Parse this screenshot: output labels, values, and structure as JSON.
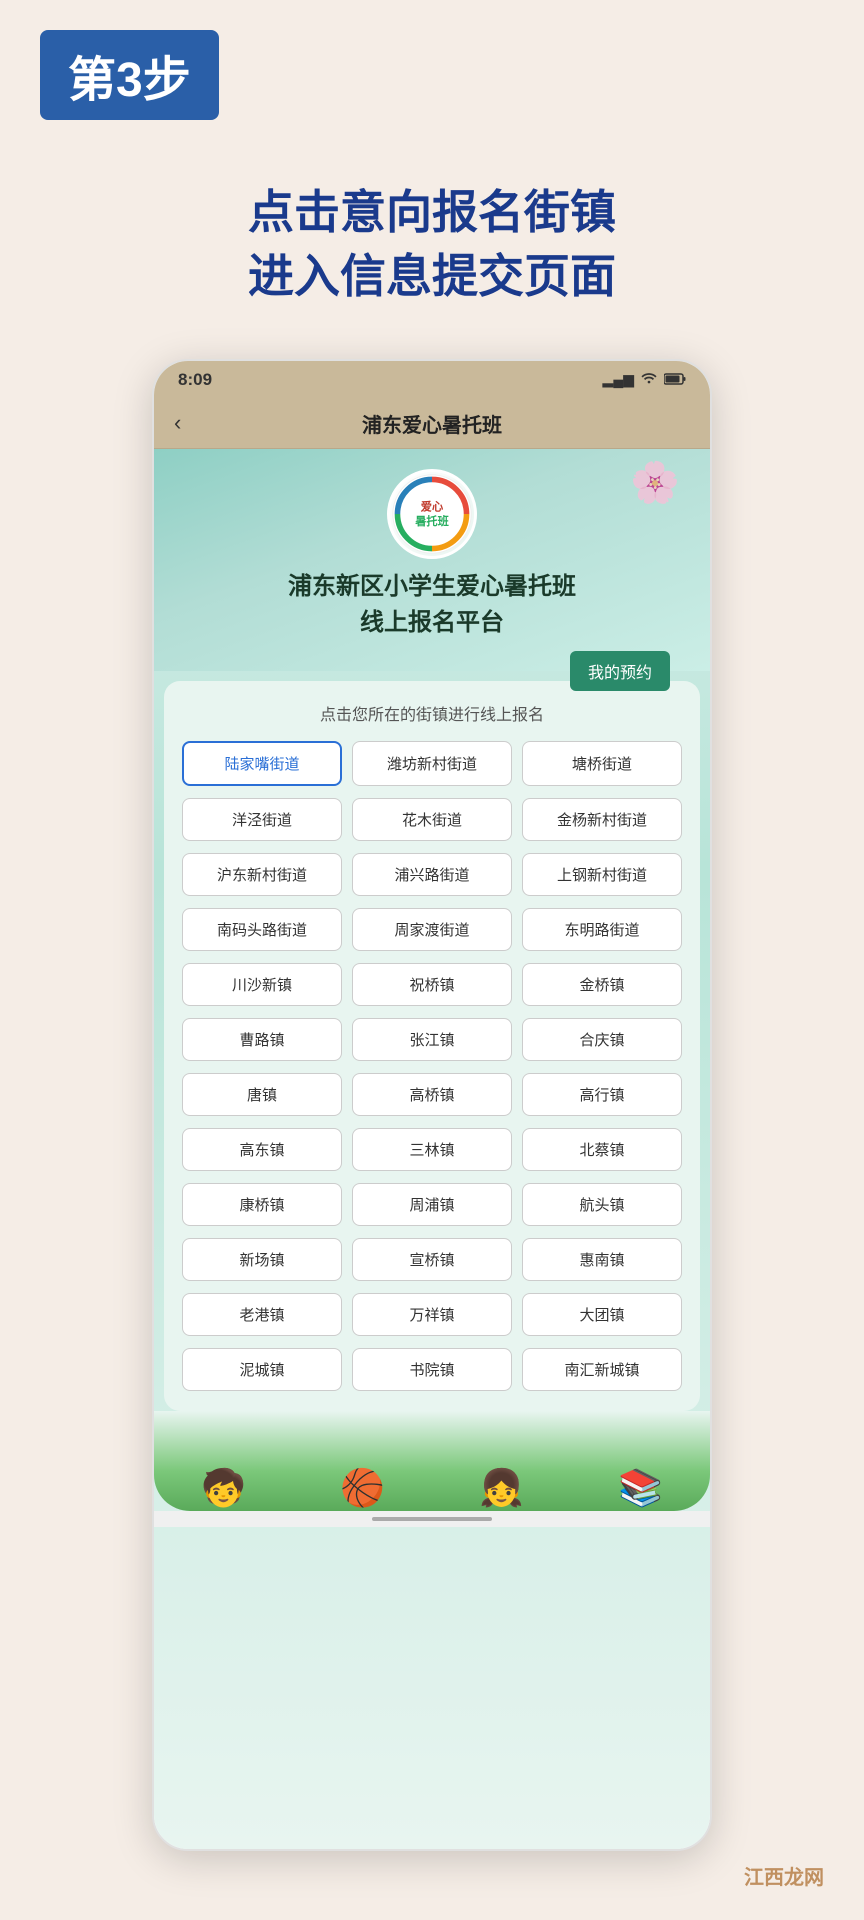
{
  "page": {
    "background_color": "#f5ede6"
  },
  "step_header": {
    "badge_text": "第3步"
  },
  "instruction": {
    "line1": "点击意向报名街镇",
    "line2": "进入信息提交页面"
  },
  "phone": {
    "status_bar": {
      "time": "8:09",
      "signal": "▂▄▆",
      "wifi": "WiFi",
      "battery": "🔋"
    },
    "nav": {
      "back": "‹",
      "title": "浦东爱心暑托班"
    },
    "banner": {
      "logo_text": "爱心\n暑托班",
      "title_line1": "浦东新区小学生爱心暑托班",
      "title_line2": "线上报名平台",
      "my_appointment": "我的预约"
    },
    "districts": {
      "label": "点击您所在的街镇进行线上报名",
      "rows": [
        [
          "陆家嘴街道",
          "潍坊新村街道",
          "塘桥街道"
        ],
        [
          "洋泾街道",
          "花木街道",
          "金杨新村街道"
        ],
        [
          "沪东新村街道",
          "浦兴路街道",
          "上钢新村街道"
        ],
        [
          "南码头路街道",
          "周家渡街道",
          "东明路街道"
        ],
        [
          "川沙新镇",
          "祝桥镇",
          "金桥镇"
        ],
        [
          "曹路镇",
          "张江镇",
          "合庆镇"
        ],
        [
          "唐镇",
          "高桥镇",
          "高行镇"
        ],
        [
          "高东镇",
          "三林镇",
          "北蔡镇"
        ],
        [
          "康桥镇",
          "周浦镇",
          "航头镇"
        ],
        [
          "新场镇",
          "宣桥镇",
          "惠南镇"
        ],
        [
          "老港镇",
          "万祥镇",
          "大团镇"
        ],
        [
          "泥城镇",
          "书院镇",
          "南汇新城镇"
        ]
      ],
      "active_item": "陆家嘴街道"
    }
  },
  "watermark": {
    "text": "江西龙网"
  }
}
